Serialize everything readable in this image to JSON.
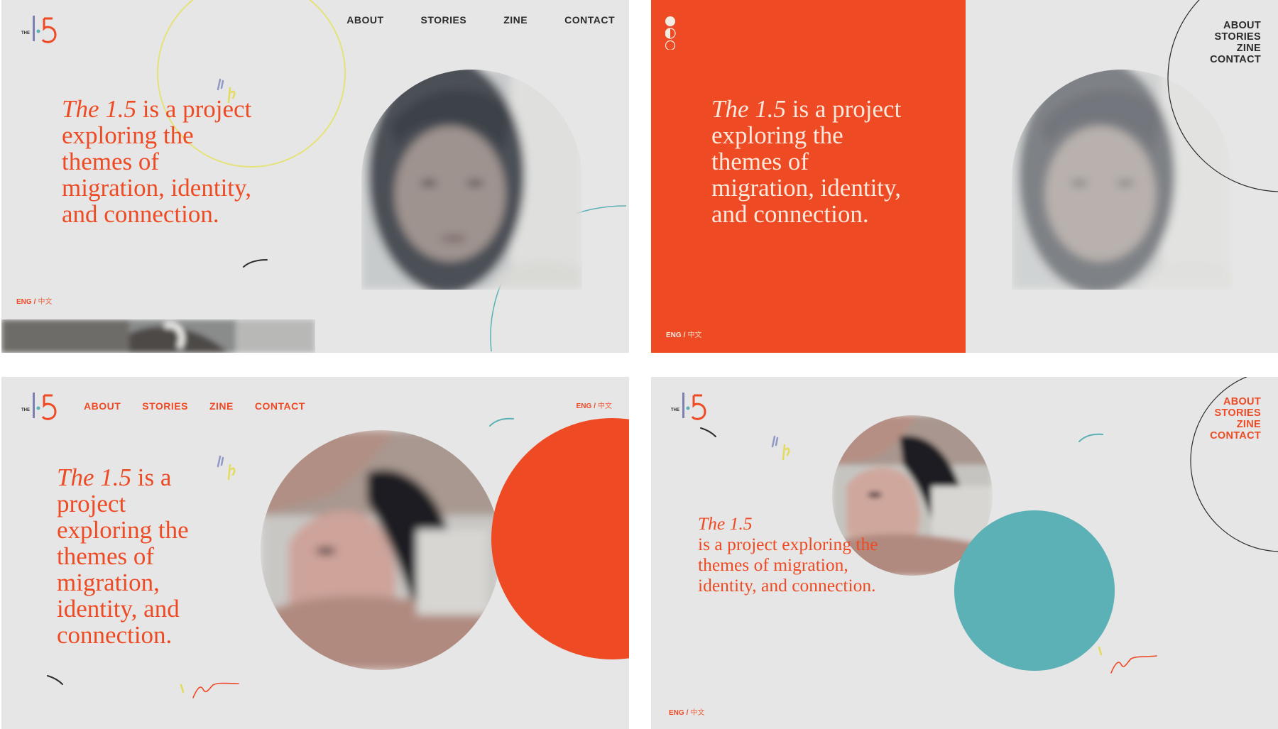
{
  "colors": {
    "accent": "#ee4a24",
    "teal": "#5bb1b5",
    "background": "#e6e6e6",
    "dark": "#2b2b2b",
    "yellow": "#e6e27a"
  },
  "logo": {
    "prefix": "THE",
    "digit_one": "1",
    "digit_five": "5"
  },
  "hero": {
    "italic": "The 1.5",
    "rest": "is a project exploring the themes of migration, identity, and connection."
  },
  "nav": {
    "about": "ABOUT",
    "stories": "STORIES",
    "zine": "ZINE",
    "contact": "CONTACT"
  },
  "language": {
    "english": "ENG",
    "separator": "/",
    "chinese": "中文"
  },
  "panels": [
    {
      "id": "variant-1",
      "background": "#e6e6e6",
      "nav_color": "#2b2b2b"
    },
    {
      "id": "variant-2",
      "background": "#ee4a24",
      "nav_color": "#2b2b2b"
    },
    {
      "id": "variant-3",
      "background": "#e6e6e6",
      "nav_color": "#ee4a24"
    },
    {
      "id": "variant-4",
      "background": "#e6e6e6",
      "nav_color": "#ee4a24"
    }
  ]
}
